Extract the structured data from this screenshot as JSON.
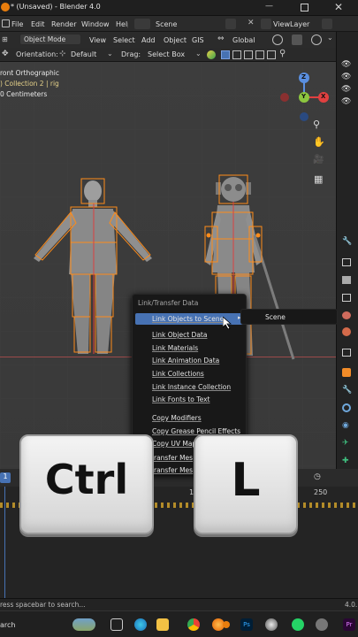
{
  "window": {
    "title": "* (Unsaved) - Blender 4.0",
    "scene_label": "Scene",
    "viewlayer_label": "ViewLayer"
  },
  "menus": [
    "File",
    "Edit",
    "Render",
    "Window",
    "Help"
  ],
  "header": {
    "mode": "Object Mode",
    "view": "View",
    "select": "Select",
    "add": "Add",
    "object": "Object",
    "gis": "GIS",
    "transform": "Global"
  },
  "toolbar": {
    "orientation_label": "Orientation:",
    "orientation_value": "Default",
    "drag_label": "Drag:",
    "drag_value": "Select Box"
  },
  "viewport": {
    "line1": "ront Orthographic",
    "line2": ") Collection 2 | rig",
    "line3": "0 Centimeters",
    "axis_x": "X",
    "axis_y": "Y",
    "axis_z": "Z"
  },
  "context_menu": {
    "title": "Link/Transfer Data",
    "items": [
      "Link Objects to Scene",
      "Link Object Data",
      "Link Materials",
      "Link Animation Data",
      "Link Collections",
      "Link Instance Collection",
      "Link Fonts to Text",
      "Copy Modifiers",
      "Copy Grease Pencil Effects",
      "Copy UV Maps",
      "ransfer Mes",
      "ransfer Mes"
    ],
    "submenu_item": "Scene"
  },
  "keys": {
    "ctrl": "Ctrl",
    "l": "L"
  },
  "timeline": {
    "frame_start": "1",
    "frame_end": "250",
    "current_frame": "1"
  },
  "status": {
    "hint": "ress spacebar to search...",
    "version": "4.0."
  },
  "taskbar": {
    "search": "arch"
  },
  "colors": {
    "accent_orange": "#ff8c1a",
    "menu_highlight": "#4772b3",
    "bg": "#3d3d3d"
  }
}
